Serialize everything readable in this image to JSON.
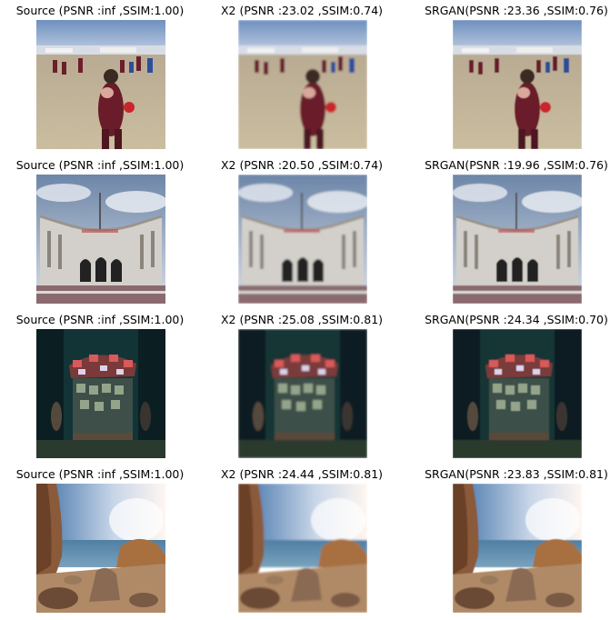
{
  "figure": {
    "rows": [
      {
        "scene": "sports-field",
        "panels": [
          {
            "title": "Source (PSNR :inf ,SSIM:1.00)"
          },
          {
            "title": "X2 (PSNR :23.02 ,SSIM:0.74)"
          },
          {
            "title": "SRGAN(PSNR :23.36 ,SSIM:0.76)"
          }
        ]
      },
      {
        "scene": "arch-building",
        "panels": [
          {
            "title": "Source (PSNR :inf ,SSIM:1.00)"
          },
          {
            "title": "X2 (PSNR :20.50 ,SSIM:0.74)"
          },
          {
            "title": "SRGAN(PSNR :19.96 ,SSIM:0.76)"
          }
        ]
      },
      {
        "scene": "night-market-stall",
        "panels": [
          {
            "title": "Source (PSNR :inf ,SSIM:1.00)"
          },
          {
            "title": "X2 (PSNR :25.08 ,SSIM:0.81)"
          },
          {
            "title": "SRGAN(PSNR :24.34 ,SSIM:0.70)"
          }
        ]
      },
      {
        "scene": "rocky-beach",
        "panels": [
          {
            "title": "Source (PSNR :inf ,SSIM:1.00)"
          },
          {
            "title": "X2 (PSNR :24.44 ,SSIM:0.81)"
          },
          {
            "title": "SRGAN(PSNR :23.83 ,SSIM:0.81)"
          }
        ]
      }
    ]
  }
}
